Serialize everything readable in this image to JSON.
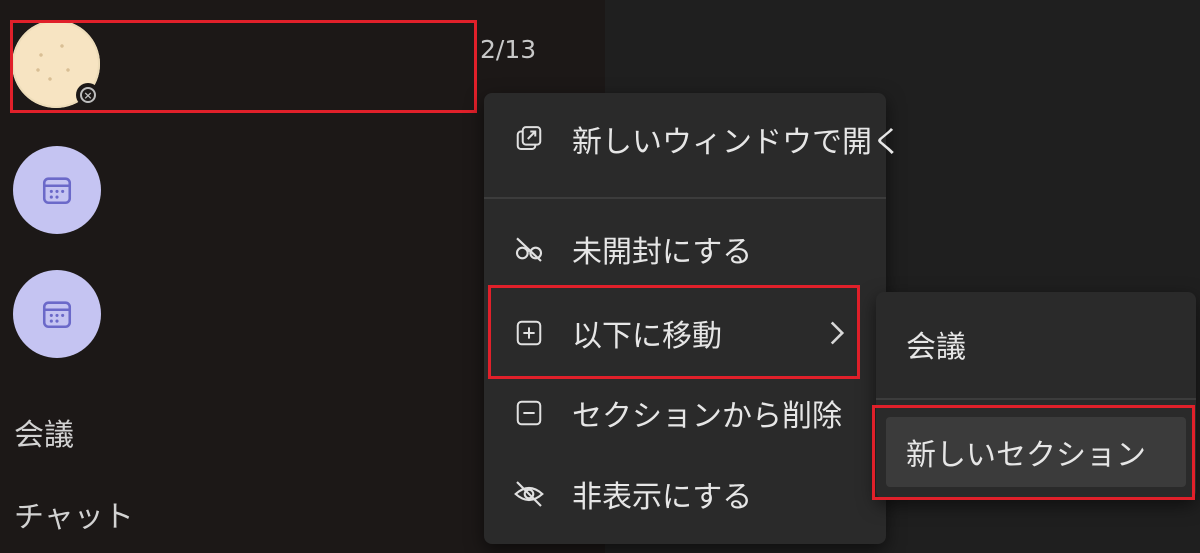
{
  "chat_list": {
    "chat_item": {
      "date": "2/13"
    },
    "sections": [
      {
        "label": "会議"
      },
      {
        "label": "チャット"
      }
    ]
  },
  "context_menu": {
    "items": [
      {
        "label": "新しいウィンドウで開く",
        "icon": "open-in-new-window-icon"
      },
      {
        "label": "未開封にする",
        "icon": "mark-unread-icon"
      },
      {
        "label": "以下に移動",
        "icon": "move-to-icon",
        "has_submenu": true
      },
      {
        "label": "セクションから削除",
        "icon": "remove-from-section-icon"
      },
      {
        "label": "非表示にする",
        "icon": "hide-icon"
      }
    ]
  },
  "submenu": {
    "items": [
      {
        "label": "会議"
      },
      {
        "label": "新しいセクション"
      }
    ]
  },
  "colors": {
    "highlight": "#e0202a",
    "calendar_avatar": "#c5c4f2",
    "menu_bg": "#2a2a2a"
  }
}
